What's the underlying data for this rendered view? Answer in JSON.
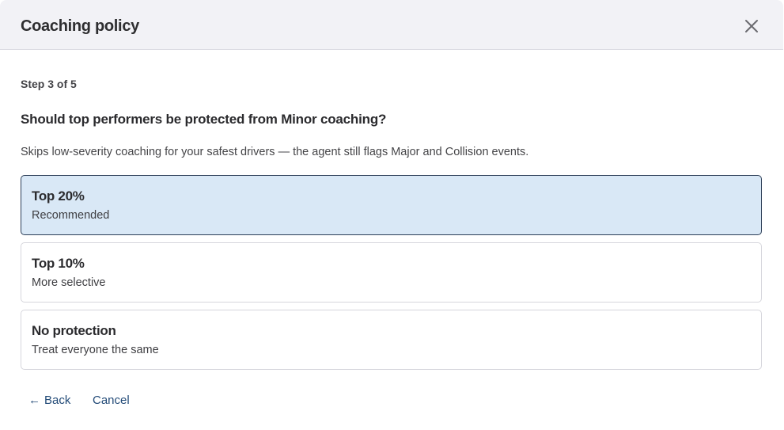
{
  "dialog": {
    "title": "Coaching policy",
    "close_icon": "close-icon"
  },
  "step": {
    "label": "Step 3 of 5"
  },
  "question": {
    "text": "Should top performers be protected from Minor coaching?",
    "description": "Skips low-severity coaching for your safest drivers — the agent still flags Major and Collision events."
  },
  "options": [
    {
      "title": "Top 20%",
      "subtitle": "Recommended",
      "selected": true
    },
    {
      "title": "Top 10%",
      "subtitle": "More selective",
      "selected": false
    },
    {
      "title": "No protection",
      "subtitle": "Treat everyone the same",
      "selected": false
    }
  ],
  "footer": {
    "back_arrow": "←",
    "back_label": "Back",
    "cancel_label": "Cancel"
  },
  "colors": {
    "header_bg": "#f2f2f6",
    "selected_bg": "#d9e8f6",
    "selected_border": "#2c3e57",
    "link": "#234b78"
  }
}
